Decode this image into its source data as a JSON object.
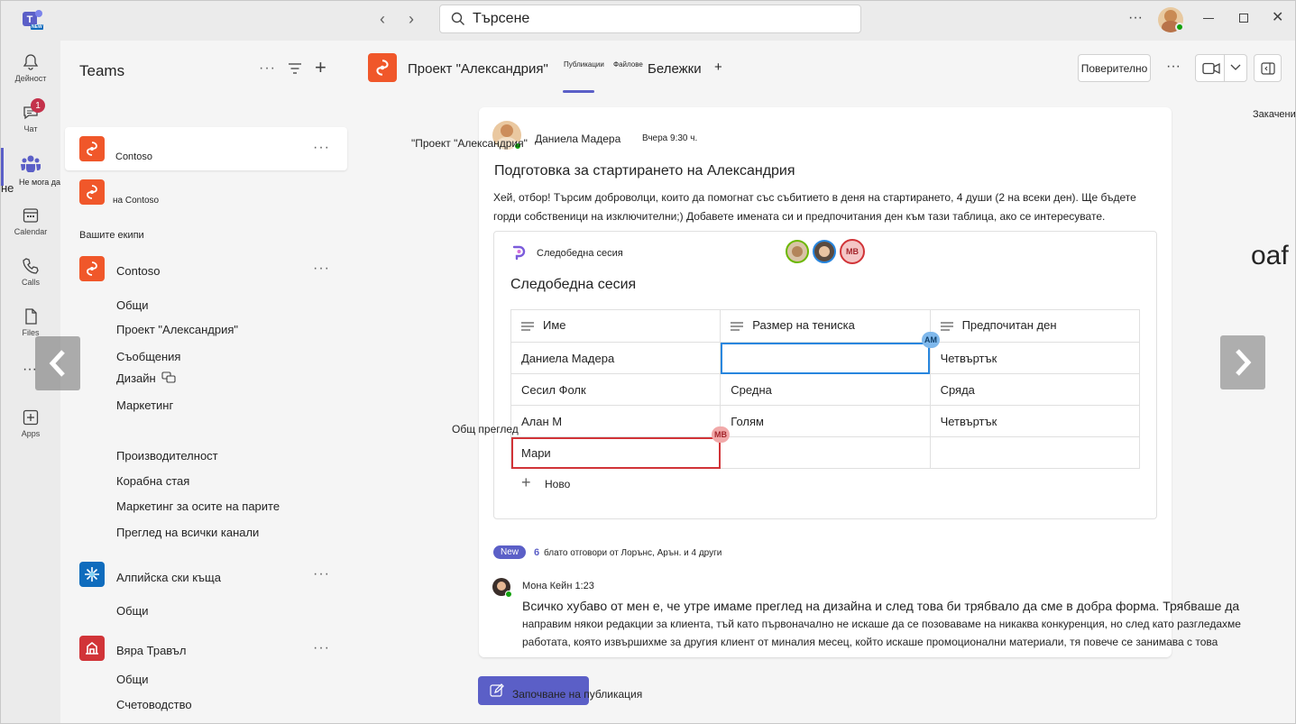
{
  "titlebar": {
    "search_placeholder": "Търсене",
    "new_badge": "NEW"
  },
  "rail": {
    "items": [
      {
        "label": "Дейност",
        "icon": "bell-icon"
      },
      {
        "label": "Чат",
        "icon": "chat-icon",
        "badge": "1"
      },
      {
        "label": "Не мога да го направя",
        "icon": "teams-icon",
        "overflow_label": "не"
      },
      {
        "label": "Calendar",
        "icon": "calendar-icon"
      },
      {
        "label": "Calls",
        "icon": "phone-icon"
      },
      {
        "label": "Files",
        "icon": "file-icon"
      },
      {
        "label": "Apps",
        "icon": "plus-square-icon"
      }
    ]
  },
  "teamlist": {
    "title": "Teams",
    "pinned": [
      {
        "name": "Contoso"
      },
      {
        "name": "на Contoso"
      }
    ],
    "section_label": "Вашите екипи",
    "teams": [
      {
        "name": "Contoso",
        "channels": [
          "Общи",
          "Проект \"Александрия\"",
          "Съобщения",
          "Дизайн",
          "Маркетинг",
          "Производителност",
          "Корабна стая",
          "Маркетинг за осите на парите",
          "Преглед на всички канали"
        ]
      },
      {
        "name": "Алпийска ски къща",
        "channels": [
          "Общи"
        ]
      },
      {
        "name": "Вяра Травъл",
        "channels": [
          "Общи",
          "Счетоводство"
        ]
      }
    ]
  },
  "header": {
    "channel_title": "Проект \"Александрия\"",
    "tabs": [
      "Публикации",
      "Файлове",
      "Бележки"
    ],
    "add_tab": "+",
    "confidential_button": "Поверително",
    "pinned_label": "Закачени",
    "overflow_text": "oaf"
  },
  "post": {
    "floating_label": "\"Проект \"Александрия\"",
    "author": "Даниела Мадера",
    "timestamp": "Вчера 9:30 ч.",
    "title": "Подготовка за стартирането на Александрия",
    "body_line1": "Хей, отбор! Търсим доброволци, които да помогнат със събитието в деня на стартирането, 4 души (2 на всеки ден). Ще бъдете",
    "body_line2": "горди собственици на изключителни;) Добавете имената си и предпочитания ден към тази таблица, ако се интересувате.",
    "loop": {
      "app_label": "Следобедна сесия",
      "title": "Следобедна сесия",
      "presence": [
        "avatar-1",
        "avatar-2",
        "MB"
      ],
      "columns": [
        "Име",
        "Размер на тениска",
        "Предпочитан ден"
      ],
      "rows": [
        [
          "Даниела Мадера",
          "",
          "Четвъртък"
        ],
        [
          "Сесил Фолк",
          "Средна",
          "Сряда"
        ],
        [
          "Алан М",
          "Голям",
          "Четвъртък"
        ],
        [
          "Мари",
          "",
          ""
        ]
      ],
      "cursor_am": "AM",
      "cursor_mb": "MB",
      "floating_label": "Общ преглед",
      "new_row": "Ново"
    },
    "replies_badge": "New",
    "replies_count": "6",
    "replies_text": "блато отговори от Лорънс, Арън. и 4 други",
    "reply": {
      "author": "Мона Кейн 1:23",
      "line1": "Всичко хубаво от мен е, че утре имаме преглед на дизайна и след това би трябвало да сме в добра форма. Трябваше да",
      "line2": "направим някои редакции за клиента, тъй като първоначално не искаше да се позоваваме на никаква конкуренция, но след като разгледахме",
      "line3": "работата, която извършихме за другия клиент от миналия месец, който искаше промоционални материали, тя повече се занимава с това"
    }
  },
  "compose": {
    "button_label": "Започване на публикация"
  },
  "colors": {
    "brand_purple": "#5b5fc7",
    "team_orange": "#f0572a",
    "team_red": "#d13438",
    "team_blue": "#0f6cbd",
    "cursor_blue": "#2886de",
    "cursor_red": "#d13438"
  }
}
